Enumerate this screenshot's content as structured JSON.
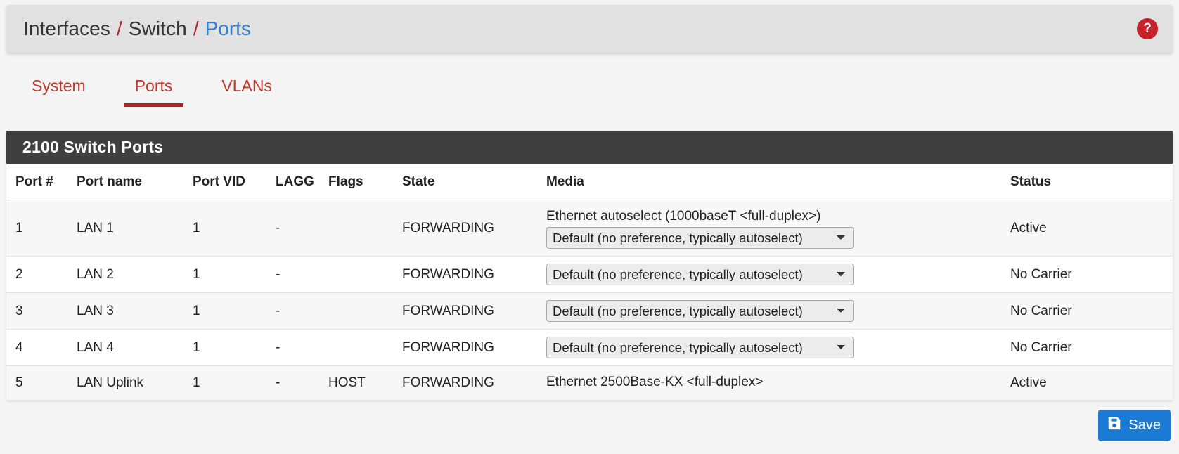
{
  "breadcrumb": {
    "items": [
      "Interfaces",
      "Switch"
    ],
    "separator": "/",
    "current": "Ports",
    "help_label": "?"
  },
  "tabs": [
    {
      "label": "System",
      "active": false
    },
    {
      "label": "Ports",
      "active": true
    },
    {
      "label": "VLANs",
      "active": false
    }
  ],
  "panel": {
    "title": "2100 Switch Ports",
    "columns": [
      "Port #",
      "Port name",
      "Port VID",
      "LAGG",
      "Flags",
      "State",
      "Media",
      "Status"
    ],
    "rows": [
      {
        "port": "1",
        "name": "LAN 1",
        "vid": "1",
        "lagg": "-",
        "flags": "",
        "state": "FORWARDING",
        "media_text": "Ethernet autoselect (1000baseT <full-duplex>)",
        "media_select": "Default (no preference, typically autoselect)",
        "status": "Active",
        "status_kind": "active"
      },
      {
        "port": "2",
        "name": "LAN 2",
        "vid": "1",
        "lagg": "-",
        "flags": "",
        "state": "FORWARDING",
        "media_text": "",
        "media_select": "Default (no preference, typically autoselect)",
        "status": "No Carrier",
        "status_kind": "down"
      },
      {
        "port": "3",
        "name": "LAN 3",
        "vid": "1",
        "lagg": "-",
        "flags": "",
        "state": "FORWARDING",
        "media_text": "",
        "media_select": "Default (no preference, typically autoselect)",
        "status": "No Carrier",
        "status_kind": "down"
      },
      {
        "port": "4",
        "name": "LAN 4",
        "vid": "1",
        "lagg": "-",
        "flags": "",
        "state": "FORWARDING",
        "media_text": "",
        "media_select": "Default (no preference, typically autoselect)",
        "status": "No Carrier",
        "status_kind": "down"
      },
      {
        "port": "5",
        "name": "LAN Uplink",
        "vid": "1",
        "lagg": "-",
        "flags": "HOST",
        "state": "FORWARDING",
        "media_text": "Ethernet 2500Base-KX <full-duplex>",
        "media_select": "",
        "status": "Active",
        "status_kind": "active"
      }
    ]
  },
  "footer": {
    "save_label": "Save",
    "save_icon": "save-floppy-icon"
  },
  "colors": {
    "accent_red": "#c0392b",
    "link_blue": "#3a80c8",
    "status_active": "#2ea44f",
    "status_down": "#c0392b",
    "save_blue": "#1a7ad4",
    "panel_head": "#3f3f3f",
    "page_bg": "#f4f4f4"
  }
}
